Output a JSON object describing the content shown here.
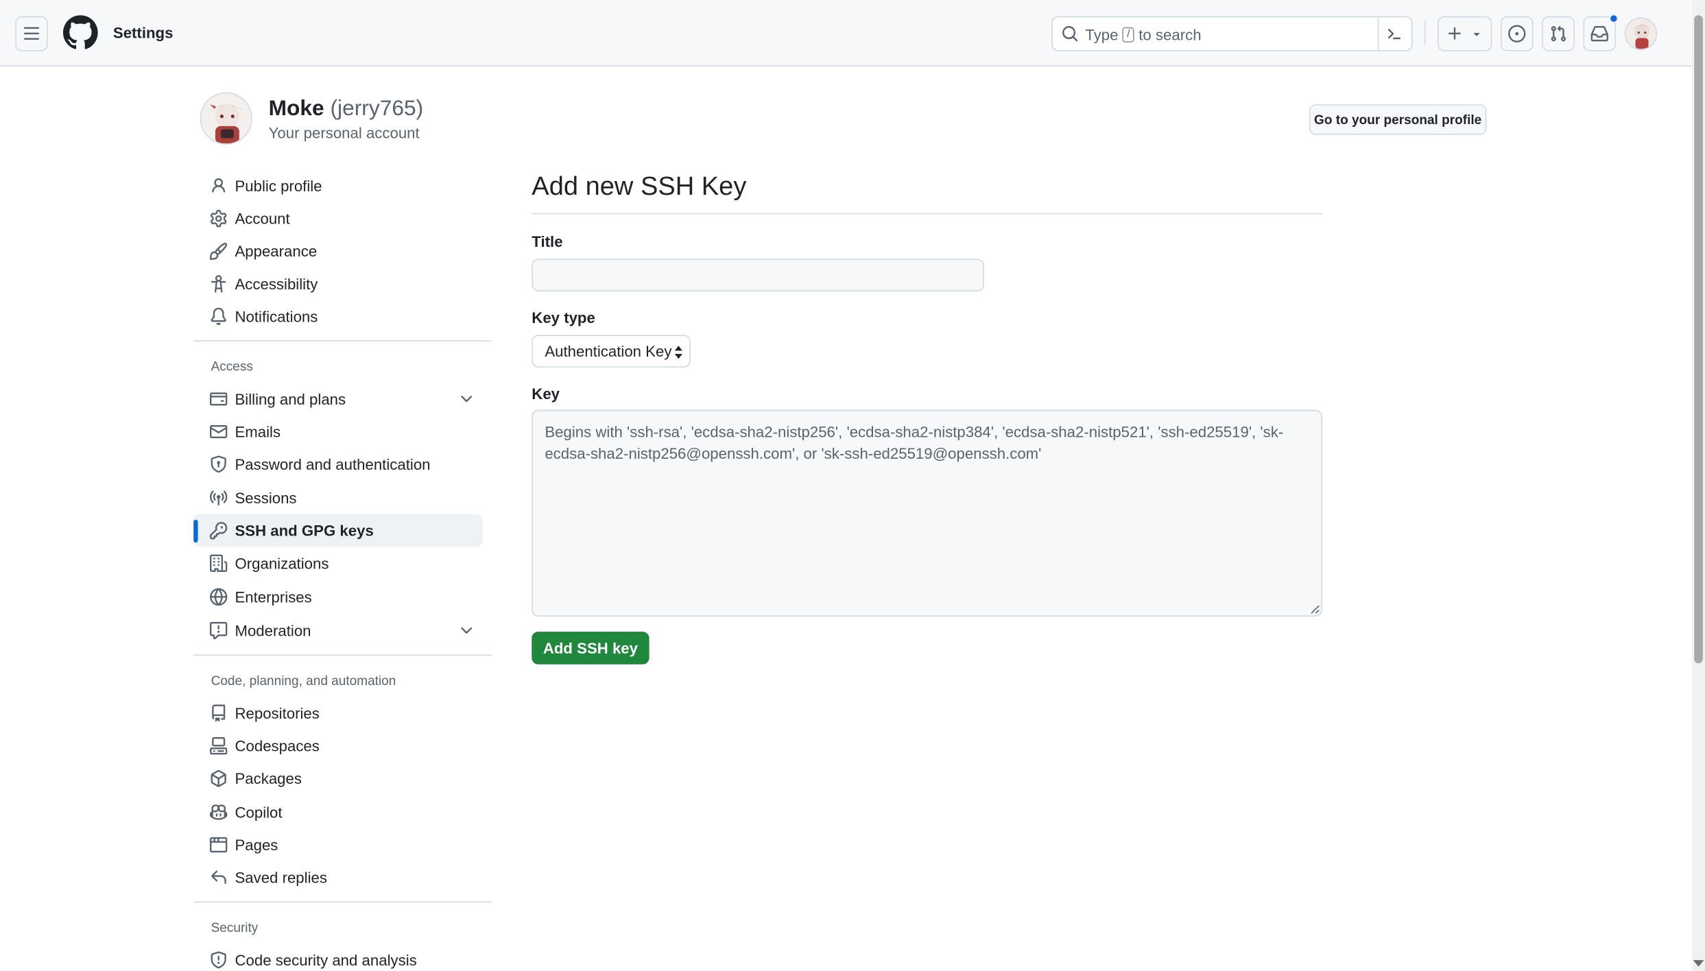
{
  "header": {
    "title": "Settings",
    "search_prefix": "Type",
    "search_key": "/",
    "search_suffix": "to search"
  },
  "profile": {
    "name": "Moke",
    "login": "(jerry765)",
    "subtitle": "Your personal account",
    "go_to_profile_label": "Go to your personal profile"
  },
  "sidebar": {
    "top_items": [
      {
        "label": "Public profile",
        "icon": "person-icon"
      },
      {
        "label": "Account",
        "icon": "gear-icon"
      },
      {
        "label": "Appearance",
        "icon": "paintbrush-icon"
      },
      {
        "label": "Accessibility",
        "icon": "accessibility-icon"
      },
      {
        "label": "Notifications",
        "icon": "bell-icon"
      }
    ],
    "access_heading": "Access",
    "access_items": [
      {
        "label": "Billing and plans",
        "icon": "credit-card-icon",
        "expandable": true
      },
      {
        "label": "Emails",
        "icon": "mail-icon"
      },
      {
        "label": "Password and authentication",
        "icon": "shield-lock-icon"
      },
      {
        "label": "Sessions",
        "icon": "broadcast-icon"
      },
      {
        "label": "SSH and GPG keys",
        "icon": "key-icon",
        "active": true
      },
      {
        "label": "Organizations",
        "icon": "organization-icon"
      },
      {
        "label": "Enterprises",
        "icon": "globe-icon"
      },
      {
        "label": "Moderation",
        "icon": "report-icon",
        "expandable": true
      }
    ],
    "code_heading": "Code, planning, and automation",
    "code_items": [
      {
        "label": "Repositories",
        "icon": "repo-icon"
      },
      {
        "label": "Codespaces",
        "icon": "codespaces-icon"
      },
      {
        "label": "Packages",
        "icon": "package-icon"
      },
      {
        "label": "Copilot",
        "icon": "copilot-icon"
      },
      {
        "label": "Pages",
        "icon": "browser-icon"
      },
      {
        "label": "Saved replies",
        "icon": "reply-icon"
      }
    ],
    "security_heading": "Security",
    "security_items": [
      {
        "label": "Code security and analysis",
        "icon": "shield-icon"
      }
    ]
  },
  "form": {
    "heading": "Add new SSH Key",
    "title_label": "Title",
    "title_value": "",
    "key_type_label": "Key type",
    "key_type_value": "Authentication Key",
    "key_label": "Key",
    "key_placeholder": "Begins with 'ssh-rsa', 'ecdsa-sha2-nistp256', 'ecdsa-sha2-nistp384', 'ecdsa-sha2-nistp521', 'ssh-ed25519', 'sk-ecdsa-sha2-nistp256@openssh.com', or 'sk-ssh-ed25519@openssh.com'",
    "submit_label": "Add SSH key"
  },
  "colors": {
    "accent_blue": "#0969da",
    "primary_green": "#1f883d",
    "header_bg": "#f6f8fa"
  }
}
